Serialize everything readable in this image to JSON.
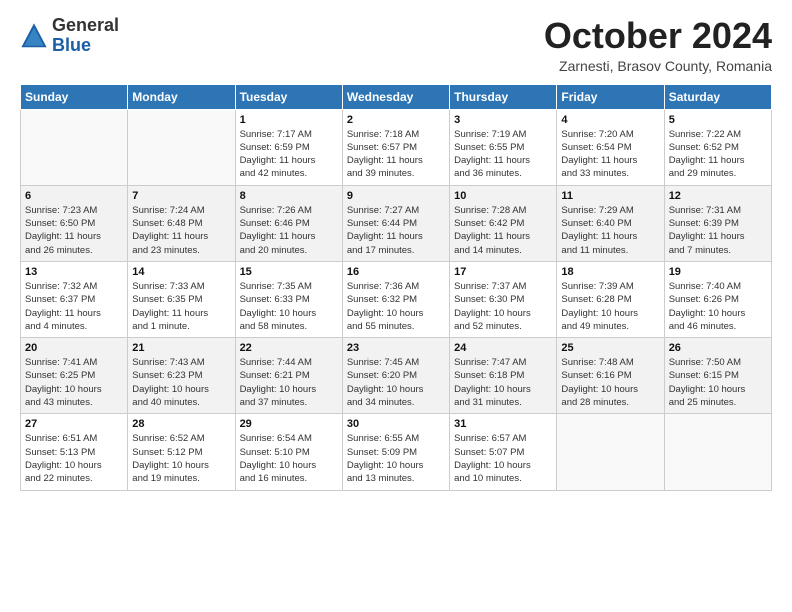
{
  "logo": {
    "general": "General",
    "blue": "Blue"
  },
  "header": {
    "month": "October 2024",
    "location": "Zarnesti, Brasov County, Romania"
  },
  "weekdays": [
    "Sunday",
    "Monday",
    "Tuesday",
    "Wednesday",
    "Thursday",
    "Friday",
    "Saturday"
  ],
  "weeks": [
    [
      {
        "day": "",
        "info": ""
      },
      {
        "day": "",
        "info": ""
      },
      {
        "day": "1",
        "info": "Sunrise: 7:17 AM\nSunset: 6:59 PM\nDaylight: 11 hours\nand 42 minutes."
      },
      {
        "day": "2",
        "info": "Sunrise: 7:18 AM\nSunset: 6:57 PM\nDaylight: 11 hours\nand 39 minutes."
      },
      {
        "day": "3",
        "info": "Sunrise: 7:19 AM\nSunset: 6:55 PM\nDaylight: 11 hours\nand 36 minutes."
      },
      {
        "day": "4",
        "info": "Sunrise: 7:20 AM\nSunset: 6:54 PM\nDaylight: 11 hours\nand 33 minutes."
      },
      {
        "day": "5",
        "info": "Sunrise: 7:22 AM\nSunset: 6:52 PM\nDaylight: 11 hours\nand 29 minutes."
      }
    ],
    [
      {
        "day": "6",
        "info": "Sunrise: 7:23 AM\nSunset: 6:50 PM\nDaylight: 11 hours\nand 26 minutes."
      },
      {
        "day": "7",
        "info": "Sunrise: 7:24 AM\nSunset: 6:48 PM\nDaylight: 11 hours\nand 23 minutes."
      },
      {
        "day": "8",
        "info": "Sunrise: 7:26 AM\nSunset: 6:46 PM\nDaylight: 11 hours\nand 20 minutes."
      },
      {
        "day": "9",
        "info": "Sunrise: 7:27 AM\nSunset: 6:44 PM\nDaylight: 11 hours\nand 17 minutes."
      },
      {
        "day": "10",
        "info": "Sunrise: 7:28 AM\nSunset: 6:42 PM\nDaylight: 11 hours\nand 14 minutes."
      },
      {
        "day": "11",
        "info": "Sunrise: 7:29 AM\nSunset: 6:40 PM\nDaylight: 11 hours\nand 11 minutes."
      },
      {
        "day": "12",
        "info": "Sunrise: 7:31 AM\nSunset: 6:39 PM\nDaylight: 11 hours\nand 7 minutes."
      }
    ],
    [
      {
        "day": "13",
        "info": "Sunrise: 7:32 AM\nSunset: 6:37 PM\nDaylight: 11 hours\nand 4 minutes."
      },
      {
        "day": "14",
        "info": "Sunrise: 7:33 AM\nSunset: 6:35 PM\nDaylight: 11 hours\nand 1 minute."
      },
      {
        "day": "15",
        "info": "Sunrise: 7:35 AM\nSunset: 6:33 PM\nDaylight: 10 hours\nand 58 minutes."
      },
      {
        "day": "16",
        "info": "Sunrise: 7:36 AM\nSunset: 6:32 PM\nDaylight: 10 hours\nand 55 minutes."
      },
      {
        "day": "17",
        "info": "Sunrise: 7:37 AM\nSunset: 6:30 PM\nDaylight: 10 hours\nand 52 minutes."
      },
      {
        "day": "18",
        "info": "Sunrise: 7:39 AM\nSunset: 6:28 PM\nDaylight: 10 hours\nand 49 minutes."
      },
      {
        "day": "19",
        "info": "Sunrise: 7:40 AM\nSunset: 6:26 PM\nDaylight: 10 hours\nand 46 minutes."
      }
    ],
    [
      {
        "day": "20",
        "info": "Sunrise: 7:41 AM\nSunset: 6:25 PM\nDaylight: 10 hours\nand 43 minutes."
      },
      {
        "day": "21",
        "info": "Sunrise: 7:43 AM\nSunset: 6:23 PM\nDaylight: 10 hours\nand 40 minutes."
      },
      {
        "day": "22",
        "info": "Sunrise: 7:44 AM\nSunset: 6:21 PM\nDaylight: 10 hours\nand 37 minutes."
      },
      {
        "day": "23",
        "info": "Sunrise: 7:45 AM\nSunset: 6:20 PM\nDaylight: 10 hours\nand 34 minutes."
      },
      {
        "day": "24",
        "info": "Sunrise: 7:47 AM\nSunset: 6:18 PM\nDaylight: 10 hours\nand 31 minutes."
      },
      {
        "day": "25",
        "info": "Sunrise: 7:48 AM\nSunset: 6:16 PM\nDaylight: 10 hours\nand 28 minutes."
      },
      {
        "day": "26",
        "info": "Sunrise: 7:50 AM\nSunset: 6:15 PM\nDaylight: 10 hours\nand 25 minutes."
      }
    ],
    [
      {
        "day": "27",
        "info": "Sunrise: 6:51 AM\nSunset: 5:13 PM\nDaylight: 10 hours\nand 22 minutes."
      },
      {
        "day": "28",
        "info": "Sunrise: 6:52 AM\nSunset: 5:12 PM\nDaylight: 10 hours\nand 19 minutes."
      },
      {
        "day": "29",
        "info": "Sunrise: 6:54 AM\nSunset: 5:10 PM\nDaylight: 10 hours\nand 16 minutes."
      },
      {
        "day": "30",
        "info": "Sunrise: 6:55 AM\nSunset: 5:09 PM\nDaylight: 10 hours\nand 13 minutes."
      },
      {
        "day": "31",
        "info": "Sunrise: 6:57 AM\nSunset: 5:07 PM\nDaylight: 10 hours\nand 10 minutes."
      },
      {
        "day": "",
        "info": ""
      },
      {
        "day": "",
        "info": ""
      }
    ]
  ]
}
